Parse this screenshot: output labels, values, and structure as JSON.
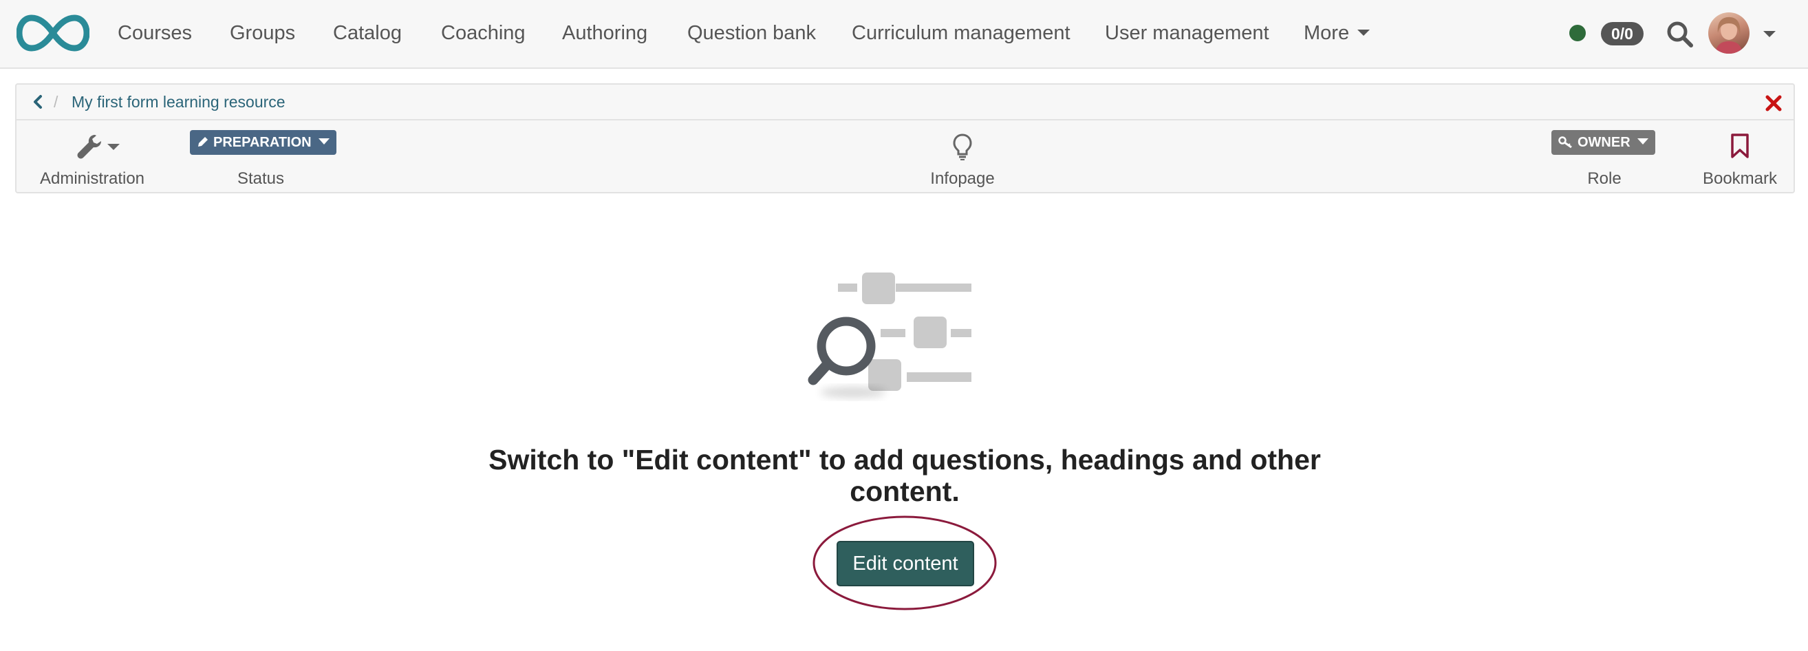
{
  "nav": {
    "items": [
      {
        "label": "Courses"
      },
      {
        "label": "Groups"
      },
      {
        "label": "Catalog"
      },
      {
        "label": "Coaching"
      },
      {
        "label": "Authoring"
      },
      {
        "label": "Question bank"
      },
      {
        "label": "Curriculum management"
      },
      {
        "label": "User management"
      },
      {
        "label": "More"
      }
    ],
    "status_color": "#2e6b3a",
    "count_badge": "0/0",
    "brand_color": "#2a8b98"
  },
  "breadcrumb": {
    "separator": "/",
    "current": "My first form learning resource"
  },
  "toolbar": {
    "administration_label": "Administration",
    "status_button": "PREPARATION",
    "status_label": "Status",
    "infopage_label": "Infopage",
    "role_button": "OWNER",
    "role_label": "Role",
    "bookmark_label": "Bookmark",
    "status_color": "#4a6785",
    "role_color": "#777777",
    "close_color": "#c81414"
  },
  "empty_state": {
    "message": "Switch to \"Edit content\" to add questions, headings and other content.",
    "edit_button": "Edit content",
    "button_color": "#2f5f5d",
    "highlight_color": "#8b1a3c"
  }
}
